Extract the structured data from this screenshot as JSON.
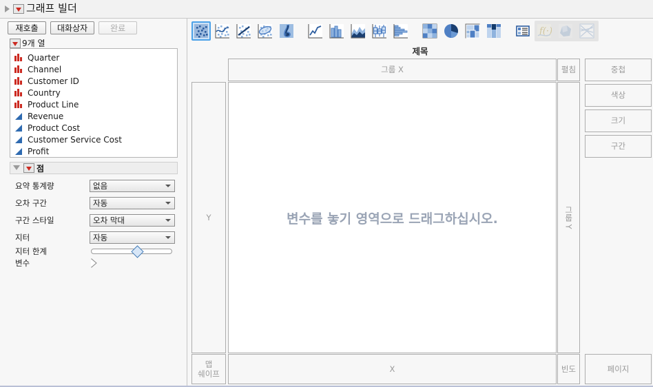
{
  "window": {
    "title": "그래프 빌더"
  },
  "commands": [
    {
      "label": "재호출",
      "enabled": true,
      "name": "recall-button"
    },
    {
      "label": "대화상자",
      "enabled": true,
      "name": "dialog-button"
    },
    {
      "label": "완료",
      "enabled": false,
      "name": "done-button"
    }
  ],
  "columns_panel": {
    "header": "9개 열",
    "items": [
      {
        "label": "Quarter",
        "type": "nominal"
      },
      {
        "label": "Channel",
        "type": "nominal"
      },
      {
        "label": "Customer ID",
        "type": "nominal"
      },
      {
        "label": "Country",
        "type": "nominal"
      },
      {
        "label": "Product Line",
        "type": "nominal"
      },
      {
        "label": "Revenue",
        "type": "continuous"
      },
      {
        "label": "Product Cost",
        "type": "continuous"
      },
      {
        "label": "Customer Service Cost",
        "type": "continuous"
      },
      {
        "label": "Profit",
        "type": "continuous"
      }
    ]
  },
  "properties_panel": {
    "header": "점",
    "rows": [
      {
        "label": "요약 통계량",
        "value": "없음",
        "control": "combo"
      },
      {
        "label": "오차 구간",
        "value": "자동",
        "control": "combo"
      },
      {
        "label": "구간 스타일",
        "value": "오차 막대",
        "control": "combo"
      },
      {
        "label": "지터",
        "value": "자동",
        "control": "combo"
      },
      {
        "label": "지터 한계",
        "value": "",
        "control": "slider"
      },
      {
        "label": "변수",
        "value": "",
        "control": "expander"
      }
    ]
  },
  "toolbar": {
    "icons": [
      {
        "name": "points-icon",
        "selected": true
      },
      {
        "name": "smoother-icon",
        "selected": false
      },
      {
        "name": "line-of-fit-icon",
        "selected": false
      },
      {
        "name": "ellipse-icon",
        "selected": false
      },
      {
        "name": "contour-icon",
        "selected": false
      },
      {
        "name": "line-chart-icon",
        "selected": false
      },
      {
        "name": "bar-chart-icon",
        "selected": false
      },
      {
        "name": "area-chart-icon",
        "selected": false
      },
      {
        "name": "box-plot-icon",
        "selected": false
      },
      {
        "name": "histogram-icon",
        "selected": false
      },
      {
        "name": "heatmap-icon",
        "selected": false
      },
      {
        "name": "pie-chart-icon",
        "selected": false
      },
      {
        "name": "treemap-icon",
        "selected": false
      },
      {
        "name": "mosaic-icon",
        "selected": false
      },
      {
        "name": "legend-icon",
        "selected": false
      },
      {
        "name": "formula-icon",
        "selected": false,
        "dimmed": true
      },
      {
        "name": "map-shape-icon",
        "selected": false,
        "dimmed": true
      },
      {
        "name": "parallel-plot-icon",
        "selected": false,
        "dimmed": true
      }
    ]
  },
  "graph": {
    "title": "제목",
    "drop_message": "변수를 놓기 영역으로 드래그하십시오.",
    "zones": {
      "group_x": "그룹 X",
      "wrap": "펼침",
      "overlay": "중첩",
      "color": "색상",
      "size": "크기",
      "interval": "구간",
      "y": "Y",
      "group_y": "그룹 Y",
      "x": "X",
      "map_shape": "맵\n쉐이프",
      "map_shape_line1": "맵",
      "map_shape_line2": "쉐이프",
      "freq": "빈도",
      "page": "페이지"
    }
  },
  "colors": {
    "accent_blue": "#2b5c9e",
    "nominal_red": "#cc2a21",
    "continuous_blue": "#2e6ab0",
    "selection": "#4da2e8",
    "drop_text": "#9aa4b5"
  }
}
